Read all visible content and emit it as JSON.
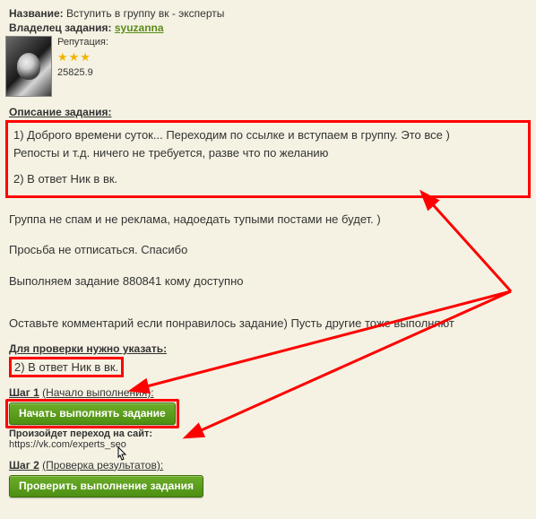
{
  "title_label": "Название:",
  "title_value": "Вступить в группу вк - эксперты",
  "owner_label": "Владелец задания:",
  "owner_name": "syuzanna",
  "reputation_label": "Репутация:",
  "stars": "★★★",
  "reputation_value": "25825.9",
  "desc_label": "Описание задания:",
  "desc_box_line1": "1) Доброго времени суток... Переходим по ссылке и вступаем в группу. Это все )",
  "desc_box_line2": "Репосты и т.д. ничего не требуется, разве что по желанию",
  "desc_box_line3": "2) В ответ Ник в вк.",
  "desc_extra1": "Группа не спам и не реклама, надоедать тупыми постами не будет. )",
  "desc_extra2": "Просьба не отписаться. Спасибо",
  "desc_extra3": "Выполняем задание 880841 кому доступно",
  "desc_extra4": "Оставьте комментарий если понравилось задание) Пусть другие тоже выполняют",
  "check_label": "Для проверки нужно указать:",
  "check_value": "2) В ответ Ник в вк.",
  "step1_label": "Шаг 1",
  "step1_paren": "(Начало выполнения):",
  "start_btn": "Начать выполнять задание",
  "redirect_label": "Произойдет переход на сайт:",
  "redirect_url": "https://vk.com/experts_seo",
  "step2_label": "Шаг 2",
  "step2_paren": "(Проверка результатов):",
  "check_btn": "Проверить выполнение задания"
}
